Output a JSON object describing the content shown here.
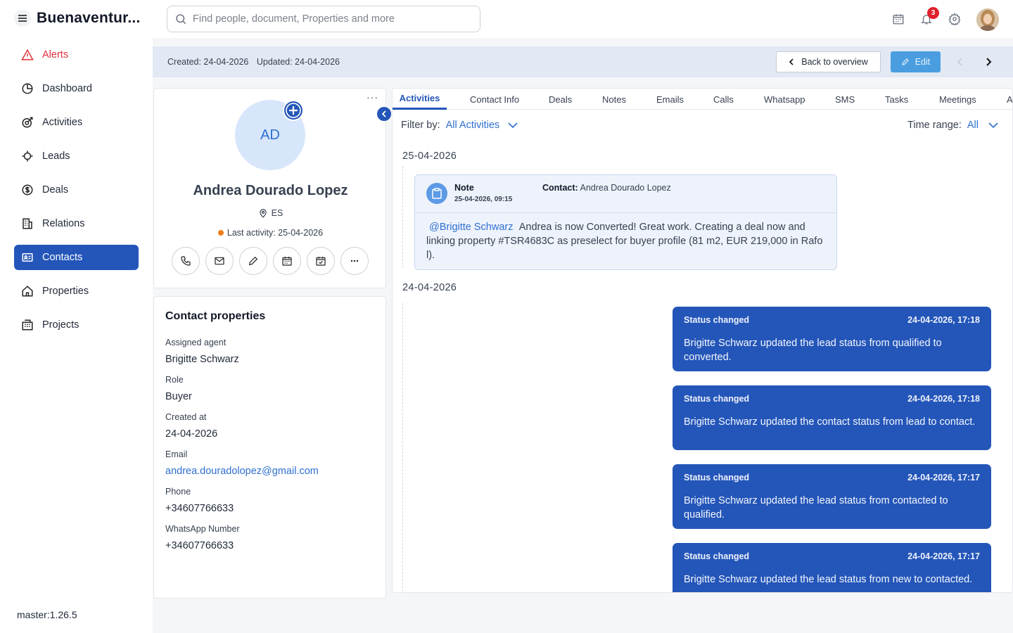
{
  "brand": {
    "name": "Buenaventur..."
  },
  "search": {
    "placeholder": "Find people, document, Properties and more"
  },
  "notifications": {
    "count": "3"
  },
  "sidebar": {
    "items": [
      {
        "label": "Alerts",
        "icon": "alert-triangle-icon"
      },
      {
        "label": "Dashboard",
        "icon": "pie-chart-icon"
      },
      {
        "label": "Activities",
        "icon": "activities-icon"
      },
      {
        "label": "Leads",
        "icon": "leads-icon"
      },
      {
        "label": "Deals",
        "icon": "dollar-circle-icon"
      },
      {
        "label": "Relations",
        "icon": "building-icon"
      },
      {
        "label": "Contacts",
        "icon": "contact-card-icon"
      },
      {
        "label": "Properties",
        "icon": "home-icon"
      },
      {
        "label": "Projects",
        "icon": "buildings-icon"
      }
    ],
    "version": "master:1.26.5"
  },
  "subheader": {
    "created": "Created: 24-04-2026",
    "updated": "Updated: 24-04-2026",
    "back_label": "Back to overview",
    "edit_label": "Edit"
  },
  "profile": {
    "initials": "AD",
    "name": "Andrea Dourado Lopez",
    "country": "ES",
    "last_activity": "Last activity: 25-04-2026",
    "more": "···"
  },
  "contact_properties": {
    "title": "Contact properties",
    "fields": [
      {
        "label": "Assigned agent",
        "value": "Brigitte Schwarz"
      },
      {
        "label": "Role",
        "value": "Buyer"
      },
      {
        "label": "Created at",
        "value": "24-04-2026"
      },
      {
        "label": "Email",
        "value": "andrea.douradolopez@gmail.com"
      },
      {
        "label": "Phone",
        "value": "+34607766633"
      },
      {
        "label": "WhatsApp Number",
        "value": "+34607766633"
      }
    ]
  },
  "tabs": [
    "Activities",
    "Contact Info",
    "Deals",
    "Notes",
    "Emails",
    "Calls",
    "Whatsapp",
    "SMS",
    "Tasks",
    "Meetings",
    "A"
  ],
  "filter": {
    "label": "Filter by:",
    "value": "All Activities"
  },
  "time_range": {
    "label": "Time range:",
    "value": "All"
  },
  "timeline": {
    "day1": "25-04-2026",
    "note": {
      "title": "Note",
      "date": "25-04-2026, 09:15",
      "contact_label": "Contact:",
      "contact_name": "Andrea Dourado Lopez",
      "mention": "@Brigitte Schwarz",
      "text_line1": "Andrea is now Converted! Great work. Creating a deal now and lin",
      "text_rest": "king property #TSR4683C as preselect for buyer profile (81 m2, EUR 219,000 in Rafo l)."
    },
    "day2": "24-04-2026",
    "status_items": [
      {
        "title": "Status changed",
        "time": "24-04-2026, 17:18",
        "text": "Brigitte Schwarz updated the lead status from qualified to converted."
      },
      {
        "title": "Status changed",
        "time": "24-04-2026, 17:18",
        "text": "Brigitte Schwarz updated the contact status from lead to contact."
      },
      {
        "title": "Status changed",
        "time": "24-04-2026, 17:17",
        "text": "Brigitte Schwarz updated the lead status from contacted to qualified."
      },
      {
        "title": "Status changed",
        "time": "24-04-2026, 17:17",
        "text": "Brigitte Schwarz updated the lead status from new to contacted."
      }
    ]
  },
  "colors": {
    "primary": "#2456b9",
    "accent": "#4a9ee0",
    "alert": "#e0313b",
    "subheader_bg": "#e2e9f4"
  }
}
